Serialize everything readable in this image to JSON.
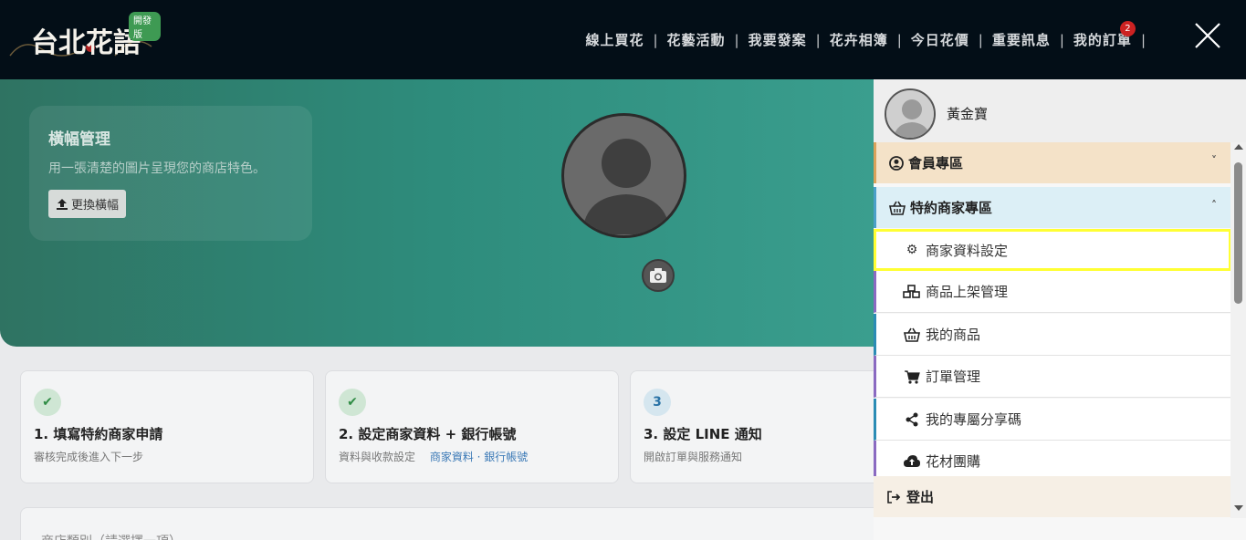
{
  "header": {
    "logo_text": "台北花語",
    "logo_badge": "開發版",
    "nav": [
      {
        "label": "線上買花"
      },
      {
        "label": "花藝活動"
      },
      {
        "label": "我要發案"
      },
      {
        "label": "花卉相簿"
      },
      {
        "label": "今日花價"
      },
      {
        "label": "重要訊息"
      },
      {
        "label": "我的訂單",
        "badge": "2"
      }
    ],
    "separator": "|",
    "close_icon": "close-icon"
  },
  "banner": {
    "title": "橫幅管理",
    "description": "用一張清楚的圖片呈現您的商店特色。",
    "button_label": "更換橫幅",
    "button_icon": "upload-icon"
  },
  "steps": [
    {
      "icon": "✔",
      "state": "done",
      "title": "1. 填寫特約商家申請",
      "sub": "審核完成後進入下一步"
    },
    {
      "icon": "✔",
      "state": "done",
      "title": "2. 設定商家資料 + 銀行帳號",
      "sub": "資料與收款設定",
      "links": "商家資料 · 銀行帳號"
    },
    {
      "icon": "3",
      "state": "num",
      "title": "3. 設定 LINE 通知",
      "sub": "開啟訂單與服務通知"
    }
  ],
  "bottom_card": {
    "text": "商店類別（請選擇一項）"
  },
  "panel": {
    "user_name": "黃金寶",
    "sections": [
      {
        "label": "會員專區",
        "icon": "user-circle-icon",
        "chevron": "˅"
      },
      {
        "label": "特約商家專區",
        "icon": "basket-icon",
        "chevron": "˄"
      }
    ],
    "items": [
      {
        "label": "商家資料設定",
        "icon": "gear-icon"
      },
      {
        "label": "商品上架管理",
        "icon": "cubes-icon"
      },
      {
        "label": "我的商品",
        "icon": "basket-icon"
      },
      {
        "label": "訂單管理",
        "icon": "cart-icon"
      },
      {
        "label": "我的專屬分享碼",
        "icon": "share-icon"
      },
      {
        "label": "花材團購",
        "icon": "cloud-upload-icon"
      }
    ],
    "logout": {
      "label": "登出",
      "icon": "sign-out-icon"
    }
  },
  "colors": {
    "header_bg": "#030e17",
    "banner": "#2e8c7c",
    "highlight": "#ffff33",
    "member_bg": "#f4e2c8",
    "merchant_bg": "#dceff6"
  }
}
